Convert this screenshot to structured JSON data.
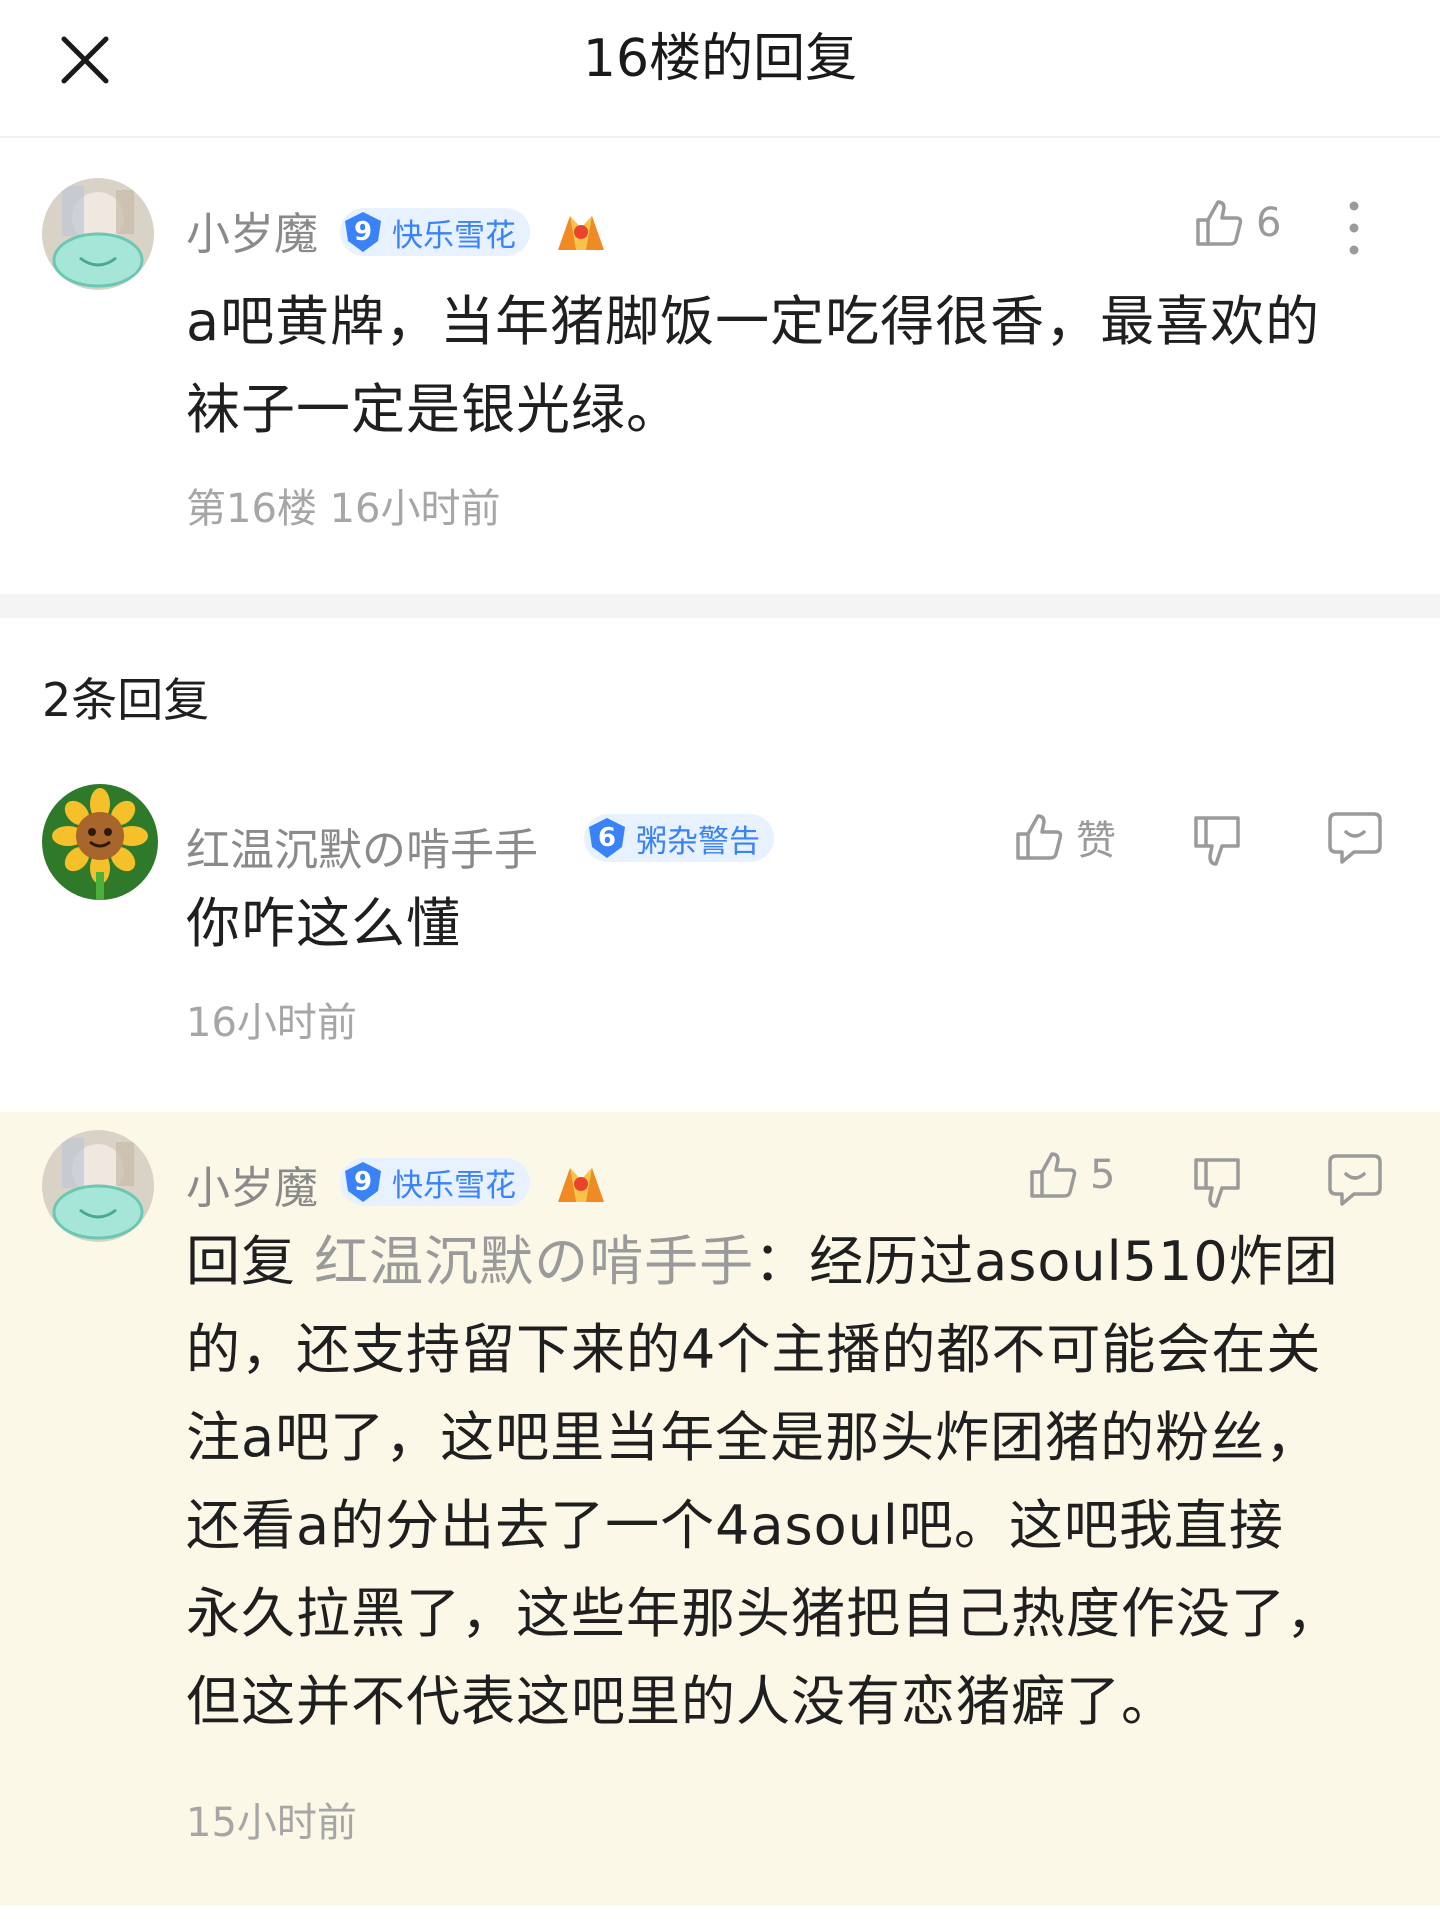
{
  "header": {
    "title": "16楼的回复",
    "close_icon": "close-icon"
  },
  "post": {
    "author": "小岁魔",
    "level": "9",
    "badge_title": "快乐雪花",
    "likes": "6",
    "content_line1": "a吧黄牌，当年猪脚饭一定吃得很香，最喜欢的",
    "content_line2": "袜子一定是银光绿。",
    "meta": "第16楼 16小时前"
  },
  "replies_section": {
    "title": "2条回复"
  },
  "replies": [
    {
      "author": "红温沉默の啃手手",
      "level": "6",
      "badge_title": "粥杂警告",
      "like_label": "赞",
      "content": "你咋这么懂",
      "time": "16小时前"
    },
    {
      "author": "小岁魔",
      "level": "9",
      "badge_title": "快乐雪花",
      "likes": "5",
      "reply_prefix": "回复",
      "mention": "红温沉默の啃手手",
      "lines": [
        "：经历过asoul510炸团",
        "的，还支持留下来的4个主播的都不可能会在关",
        "注a吧了，这吧里当年全是那头炸团猪的粉丝，",
        "还看a的分出去了一个4asoul吧。这吧我直接",
        "永久拉黑了，这些年那头猪把自己热度作没了，",
        "但这并不代表这吧里的人没有恋猪癖了。"
      ],
      "time": "15小时前"
    }
  ],
  "colors": {
    "accent_blue": "#3a82f7",
    "highlight_bg": "#fcf8e8",
    "muted_text": "#a6a6a6"
  }
}
